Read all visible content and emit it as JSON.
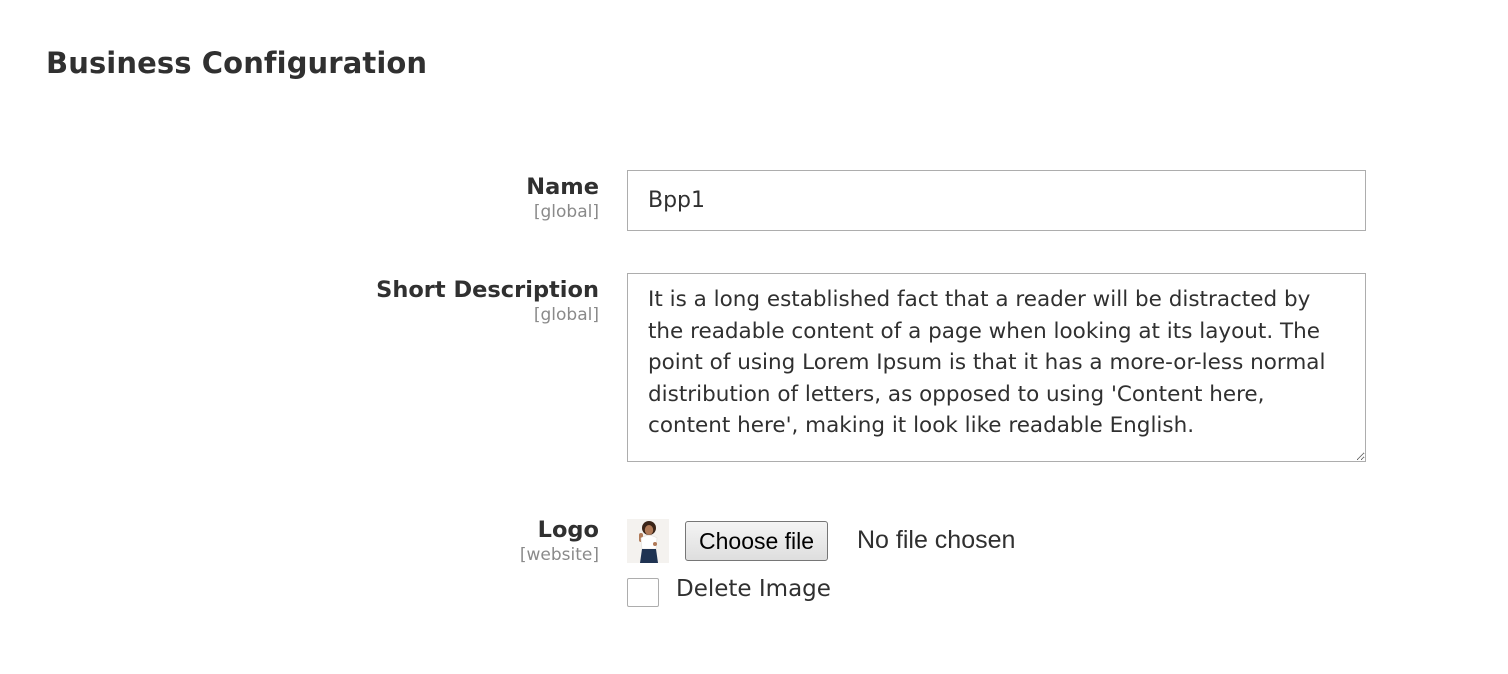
{
  "section": {
    "title": "Business Configuration"
  },
  "fields": {
    "name": {
      "label": "Name",
      "scope": "[global]",
      "value": "Bpp1"
    },
    "short_description": {
      "label": "Short Description",
      "scope": "[global]",
      "value": "It is a long established fact that a reader will be distracted by the readable content of a page when looking at its layout. The point of using Lorem Ipsum is that it has a more-or-less normal distribution of letters, as opposed to using 'Content here, content here', making it look like readable English."
    },
    "logo": {
      "label": "Logo",
      "scope": "[website]",
      "choose_file_label": "Choose file",
      "file_status": "No file chosen",
      "delete_label": "Delete Image",
      "delete_checked": false
    }
  }
}
